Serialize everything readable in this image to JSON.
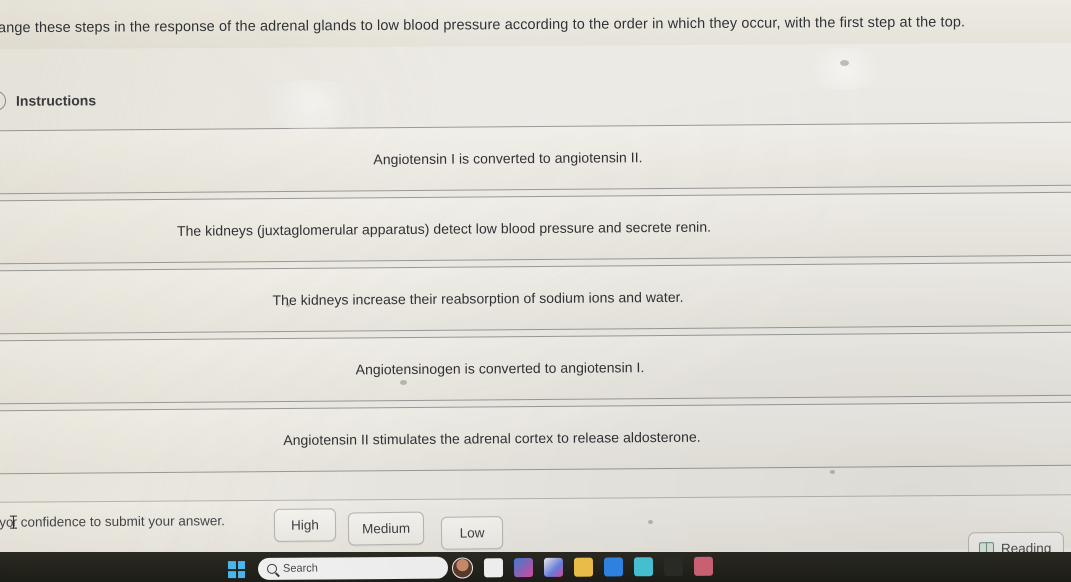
{
  "question": {
    "prompt": "ange these steps in the response of the adrenal glands to low blood pressure according to the order in which they occur, with the first step at the top."
  },
  "instructions": {
    "label": "Instructions",
    "icon": "info-circle-icon"
  },
  "options": [
    {
      "text": "Angiotensin I is converted to angiotensin II."
    },
    {
      "text": "The kidneys (juxtaglomerular apparatus) detect low blood pressure and secrete renin."
    },
    {
      "text": "The kidneys increase their reabsorption of sodium ions and water."
    },
    {
      "text": "Angiotensinogen is converted to angiotensin I."
    },
    {
      "text": "Angiotensin II stimulates the adrenal cortex to release aldosterone."
    }
  ],
  "confidence": {
    "prompt_before_caret": "e yo",
    "prompt_after_caret": "r confidence to submit your answer.",
    "buttons": [
      {
        "label": "High"
      },
      {
        "label": "Medium"
      },
      {
        "label": "Low"
      }
    ]
  },
  "reading": {
    "label": "Reading",
    "icon": "open-book-icon"
  },
  "taskbar": {
    "start": {
      "icon": "windows-start-icon"
    },
    "search": {
      "label": "Search",
      "icon": "search-icon"
    },
    "apps": [
      {
        "name": "user-avatar",
        "color": "#b07a5c"
      },
      {
        "name": "document-app",
        "color": "#f4f4f4"
      },
      {
        "name": "store-app",
        "color": "#3f7fd8"
      },
      {
        "name": "photos-app",
        "color": "#d94a9e"
      },
      {
        "name": "file-explorer",
        "color": "#f2c24a"
      },
      {
        "name": "browser-app",
        "color": "#2f86e8"
      },
      {
        "name": "teams-app",
        "color": "#48c6d8"
      },
      {
        "name": "terminal-app",
        "color": "#2b2b26"
      },
      {
        "name": "notes-app",
        "color": "#cf6477"
      }
    ]
  },
  "colors": {
    "page_bg": "#eceae4",
    "row_bg": "#f0eee8",
    "row_border": "#9a9a98",
    "text": "#303134",
    "taskbar_bg": "#1f1f1a",
    "accent_blue": "#4ab8f0"
  }
}
